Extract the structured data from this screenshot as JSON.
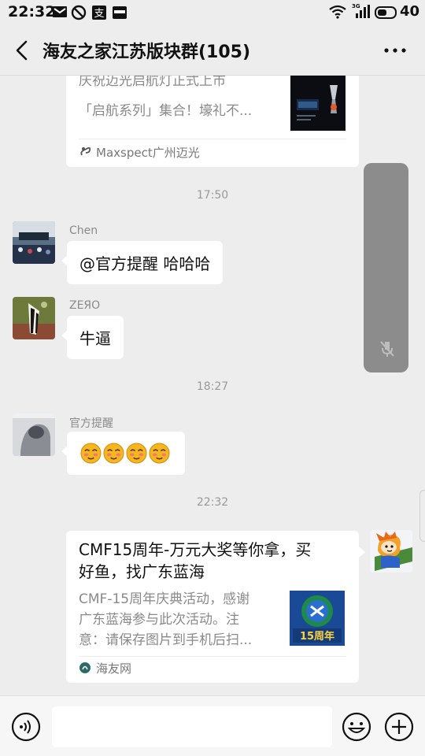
{
  "status": {
    "time": "22:32",
    "battery": "40",
    "signal_label": "3G"
  },
  "header": {
    "title": "海友之家江苏版块群(105)"
  },
  "chat": {
    "card1": {
      "title_line1": "庆祝迈光启航灯正式上市",
      "desc_line1": "「启航系列」集合！壕礼不...",
      "source": "Maxspect广州迈光"
    },
    "time1": "17:50",
    "msg_chen": {
      "sender": "Chen",
      "text": "@官方提醒  哈哈哈"
    },
    "msg_zero": {
      "sender": "ZEЯO",
      "text": "牛逼"
    },
    "time2": "18:27",
    "msg_official": {
      "sender": "官方提醒",
      "emoji_count": 4
    },
    "time3": "22:32",
    "card2": {
      "title_line1": "CMF15周年-万元大奖等你拿，买",
      "title_line2": "好鱼，找广东蓝海",
      "desc_line1": "CMF-15周年庆典活动，感谢",
      "desc_line2": "广东蓝海参与此次活动。注",
      "desc_line3": "意：请保存图片到手机后扫...",
      "source": "海友网",
      "thumb_text": "15周年"
    }
  },
  "input": {
    "placeholder": ""
  },
  "colors": {
    "background": "#ededed",
    "bubble": "#ffffff",
    "float_panel": "#8c8c8c",
    "emoji_face": "#f6b61d"
  }
}
